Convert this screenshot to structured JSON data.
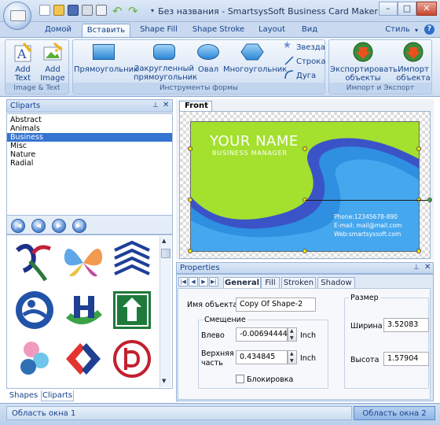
{
  "window": {
    "title": "Без названия - SmartsysSoft Business Card Maker",
    "controls": {
      "minimize": "–",
      "maximize": "□",
      "close": "✕"
    }
  },
  "ribbon": {
    "tabs": [
      "Домой",
      "Вставить",
      "Shape Fill",
      "Shape Stroke",
      "Layout",
      "Вид"
    ],
    "active_tab": "Вставить",
    "style_menu": "Стиль",
    "groups": {
      "image_text": {
        "label": "Image & Text",
        "buttons": {
          "add_text": "Add Text",
          "add_image": "Add Image"
        }
      },
      "shapes": {
        "label": "Инструменты формы",
        "buttons": {
          "rectangle": "Прямоугольник",
          "rounded_rectangle": "Закругленный прямоугольник",
          "oval": "Овал",
          "polygon": "Многоугольник",
          "star": "Звезда",
          "line": "Строка",
          "arc": "Дуга"
        }
      },
      "import_export": {
        "label": "Импорт и Экспорт",
        "buttons": {
          "export": "Экспортировать объекты",
          "import": "Импорт объекта"
        }
      }
    }
  },
  "cliparts": {
    "title": "Cliparts",
    "categories": [
      "Abstract",
      "Animals",
      "Business",
      "Misc",
      "Nature",
      "Radial"
    ],
    "selected": "Business",
    "bottom_tabs": [
      "Shapes",
      "Cliparts"
    ],
    "active_bottom_tab": "Cliparts"
  },
  "canvas": {
    "tab": "Front",
    "card": {
      "name": "YOUR NAME",
      "position": "BUSINESS  MANAGER",
      "phone": "Phone:12345678-890",
      "email": "E-mail: mail@mail.com",
      "web": "Web:smartsyssoft.com",
      "colors": {
        "background": "#a4e02e",
        "wave": "#2f8fe0",
        "wave_dark": "#3a54c8"
      }
    }
  },
  "properties": {
    "title": "Properties",
    "tabs": [
      "General",
      "Fill",
      "Stroken",
      "Shadow"
    ],
    "active_tab": "General",
    "object_name_label": "Имя объекта",
    "object_name_value": "Copy Of Shape-2",
    "offset_group": "Смещение",
    "left_label": "Влево",
    "left_value": "-0.00694444",
    "top_label_1": "Верхняя",
    "top_label_2": "часть",
    "top_value": "0.434845",
    "unit": "Inch",
    "lock_label": "Блокировка",
    "lock_checked": false,
    "size_group": "Размер",
    "width_label": "Ширина",
    "width_value": "3.52083",
    "height_label": "Высота",
    "height_value": "1.57904"
  },
  "status": {
    "pane1": "Область окна 1",
    "pane2": "Область окна 2"
  }
}
